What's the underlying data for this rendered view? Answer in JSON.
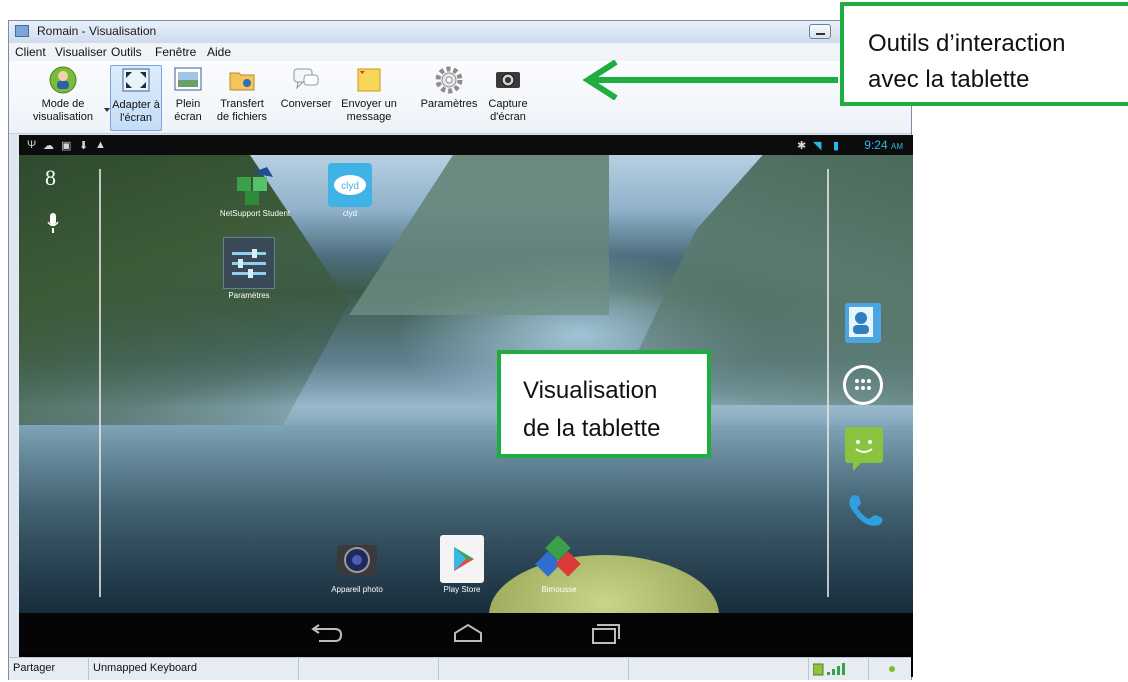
{
  "window": {
    "title": "Romain - Visualisation"
  },
  "menu": [
    "Client",
    "Visualiser",
    "Outils",
    "Fenêtre",
    "Aide"
  ],
  "toolbar": {
    "mode": [
      "Mode de",
      "visualisation"
    ],
    "adapter": [
      "Adapter à",
      "l'écran"
    ],
    "plein": [
      "Plein",
      "écran"
    ],
    "transfert": [
      "Transfert",
      "de fichiers"
    ],
    "converser": [
      "Converser"
    ],
    "envoyer": [
      "Envoyer un",
      "message"
    ],
    "parametres": [
      "Paramètres"
    ],
    "capture": [
      "Capture",
      "d'écran"
    ]
  },
  "tablet": {
    "time": "9:24",
    "time_suffix": "AM",
    "apps": {
      "student": "NetSupport Student",
      "clyd": "clyd",
      "parametres": "Paramètres",
      "camera": "Appareil photo",
      "playstore": "Play Store",
      "third": "Bimousse"
    },
    "google_g": "8"
  },
  "statusbar": {
    "partager": "Partager",
    "keyboard": "Unmapped Keyboard"
  },
  "callouts": {
    "tools": [
      "Outils d’interaction",
      "avec la tablette"
    ],
    "visual": [
      "Visualisation",
      "de la tablette"
    ]
  },
  "colors": {
    "callout_border": "#1fad3f",
    "time": "#2fb6e8"
  },
  "icons": [
    "mode-visualisation-icon",
    "fit-screen-icon",
    "fullscreen-icon",
    "file-transfer-icon",
    "chat-icon",
    "message-icon",
    "settings-gear-icon",
    "camera-icon",
    "contacts-icon",
    "app-drawer-icon",
    "messaging-icon",
    "phone-icon",
    "back-icon",
    "home-icon",
    "recent-apps-icon",
    "microphone-icon",
    "google-search-icon"
  ]
}
